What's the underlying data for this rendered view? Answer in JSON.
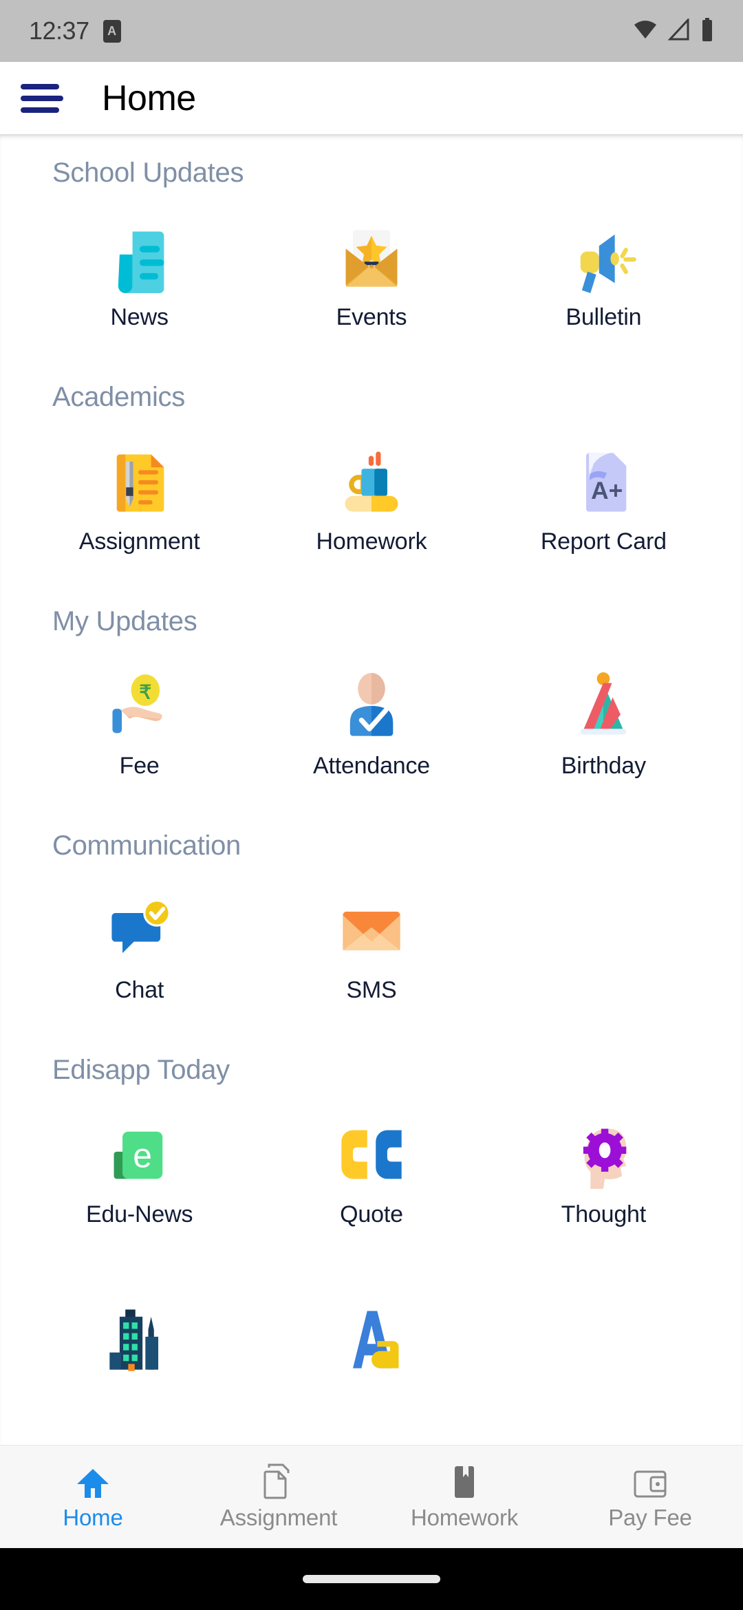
{
  "statusbar": {
    "time": "12:37",
    "app_badge": "A",
    "icons": [
      "wifi-icon",
      "signal-icon",
      "battery-icon"
    ]
  },
  "appbar": {
    "menu_icon": "hamburger-menu-icon",
    "title": "Home"
  },
  "sections": [
    {
      "title": "School Updates",
      "items": [
        {
          "label": "News",
          "icon": "news-document-icon"
        },
        {
          "label": "Events",
          "icon": "envelope-star-icon"
        },
        {
          "label": "Bulletin",
          "icon": "megaphone-icon"
        }
      ]
    },
    {
      "title": "Academics",
      "items": [
        {
          "label": "Assignment",
          "icon": "document-pen-icon"
        },
        {
          "label": "Homework",
          "icon": "mug-books-icon"
        },
        {
          "label": "Report Card",
          "icon": "a-plus-document-icon"
        }
      ]
    },
    {
      "title": "My Updates",
      "items": [
        {
          "label": "Fee",
          "icon": "hand-rupee-coin-icon"
        },
        {
          "label": "Attendance",
          "icon": "person-check-icon"
        },
        {
          "label": "Birthday",
          "icon": "party-hat-icon"
        }
      ]
    },
    {
      "title": "Communication",
      "items": [
        {
          "label": "Chat",
          "icon": "chat-bubble-check-icon"
        },
        {
          "label": "SMS",
          "icon": "orange-envelope-icon"
        }
      ]
    },
    {
      "title": "Edisapp Today",
      "items": [
        {
          "label": "Edu-News",
          "icon": "green-e-tag-icon"
        },
        {
          "label": "Quote",
          "icon": "quotation-marks-icon"
        },
        {
          "label": "Thought",
          "icon": "head-gear-icon"
        }
      ]
    }
  ],
  "partial_row": {
    "items": [
      {
        "label": "",
        "icon": "city-buildings-icon"
      },
      {
        "label": "",
        "icon": "aa-letters-icon"
      }
    ]
  },
  "bottom_nav": {
    "items": [
      {
        "label": "Home",
        "icon": "home-icon",
        "active": true
      },
      {
        "label": "Assignment",
        "icon": "copy-docs-icon",
        "active": false
      },
      {
        "label": "Homework",
        "icon": "book-icon",
        "active": false
      },
      {
        "label": "Pay Fee",
        "icon": "wallet-card-icon",
        "active": false
      }
    ]
  },
  "colors": {
    "accent_blue": "#1c8ceb",
    "menu_navy": "#1a237e",
    "section_header": "#7f8fa6",
    "label_dark": "#131c35",
    "statusbar_bg": "#c0c0c0",
    "nav_inactive": "#8b8b8b"
  }
}
